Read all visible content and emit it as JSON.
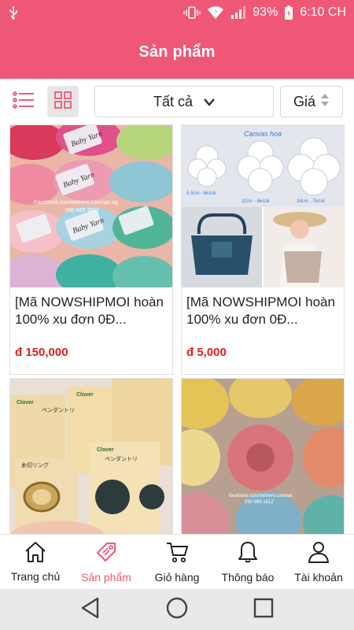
{
  "status_bar": {
    "battery": "93%",
    "time": "6:10 CH"
  },
  "header": {
    "title": "Sản phẩm"
  },
  "toolbar": {
    "filter_label": "Tất cả",
    "sort_label": "Giá"
  },
  "products": [
    {
      "name": "[Mã NOWSHIPMOI hoàn 100% xu đơn 0Đ...",
      "price": "đ 150,000"
    },
    {
      "name": "[Mã NOWSHIPMOI hoàn 100% xu đơn 0Đ...",
      "price": "đ 5,000"
    },
    {
      "name": "",
      "price": ""
    },
    {
      "name": "",
      "price": ""
    }
  ],
  "product_images": {
    "p1_watermark": "Facebook.com/tietnem.canmac.sg",
    "p1_phone": "090 899 1512",
    "p1_brand": "Baby Yarn",
    "p2_title": "Canvas hoa",
    "p2_size1": "5.5cm - 6k/cái",
    "p2_size2": "11cm - 6k/cái",
    "p2_size3": "14cm - 7k/cái",
    "p3_brand": "Clover",
    "p3_label": "ペンダントリ",
    "p3_label2": "糸切リング",
    "p4_watermark": "facebook.com/tietnem.canmac",
    "p4_phone": "090 899 1512"
  },
  "bottom_nav": [
    {
      "label": "Trang chủ",
      "icon": "home-icon"
    },
    {
      "label": "Sản phẩm",
      "icon": "tag-icon"
    },
    {
      "label": "Giỏ hàng",
      "icon": "cart-icon"
    },
    {
      "label": "Thông báo",
      "icon": "bell-icon"
    },
    {
      "label": "Tài khoản",
      "icon": "user-icon"
    }
  ],
  "colors": {
    "accent": "#ee5876",
    "price": "#e02020"
  }
}
